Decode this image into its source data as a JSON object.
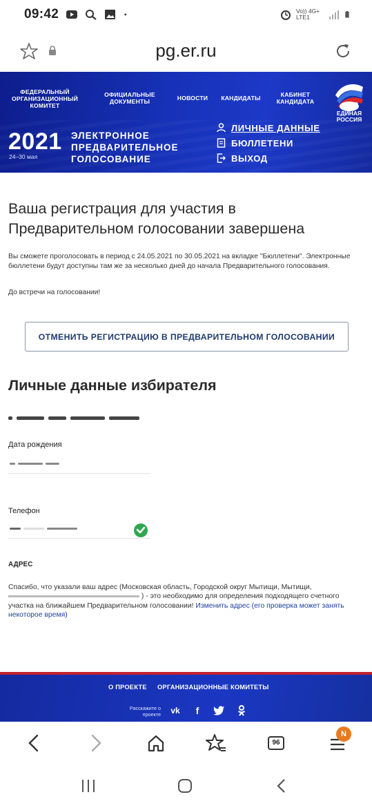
{
  "status_bar": {
    "time": "09:42",
    "network_label": "Vo)) 4G+ LTE1",
    "icons": [
      "youtube-icon",
      "search-icon",
      "gallery-icon",
      "dot-icon",
      "alarm-icon",
      "signal-icon",
      "battery-icon"
    ]
  },
  "browser": {
    "url": "pg.er.ru",
    "tab_count": "96",
    "menu_badge": "N"
  },
  "header": {
    "nav": [
      "ФЕДЕРАЛЬНЫЙ ОРГАНИЗАЦИОННЫЙ КОМИТЕТ",
      "ОФИЦИАЛЬНЫЕ ДОКУМЕНТЫ",
      "НОВОСТИ",
      "КАНДИДАТЫ",
      "КАБИНЕТ КАНДИДАТА"
    ],
    "logo_text": "ЕДИНАЯ РОССИЯ",
    "year": "2021",
    "dates": "24–30 мая",
    "event_title_1": "ЭЛЕКТРОННОЕ",
    "event_title_2": "ПРЕДВАРИТЕЛЬНОЕ",
    "event_title_3": "ГОЛОСОВАНИЕ",
    "user_menu": [
      {
        "label": "ЛИЧНЫЕ ДАННЫЕ",
        "icon": "user-icon"
      },
      {
        "label": "БЮЛЛЕТЕНИ",
        "icon": "document-icon"
      },
      {
        "label": "ВЫХОД",
        "icon": "logout-icon"
      }
    ]
  },
  "main": {
    "reg_title": "Ваша регистрация для участия в Предварительном голосовании завершена",
    "reg_text": "Вы сможете проголосовать в период с 24.05.2021 по 30.05.2021 на вкладке \"Бюллетени\". Электронные бюллетени будут доступны там же за несколько дней до начала Предварительного голосования.",
    "reg_greet": "До встречи на голосовании!",
    "cancel_button": "ОТМЕНИТЬ РЕГИСТРАЦИЮ В ПРЕДВАРИТЕЛЬНОМ ГОЛОСОВАНИИ",
    "personal_title": "Личные данные избирателя",
    "birth_label": "Дата рождения",
    "phone_label": "Телефон",
    "address_heading": "АДРЕС",
    "address_text_1": "Спасибо, что указали ваш адрес (Московская область, Городской округ Мытищи, Мытищи,",
    "address_text_2": ") - это необходимо для определения подходящего счетного участка на ближайшем Предварительном голосовании!",
    "address_link": "Изменить адрес (его проверка может занять некоторое время)"
  },
  "footer": {
    "links": [
      "О ПРОЕКТЕ",
      "ОРГАНИЗАЦИОННЫЕ КОМИТЕТЫ"
    ],
    "share_label": "Расскажите о проекте",
    "social": [
      "vk-icon",
      "facebook-icon",
      "twitter-icon",
      "odnoklassniki-icon"
    ]
  }
}
